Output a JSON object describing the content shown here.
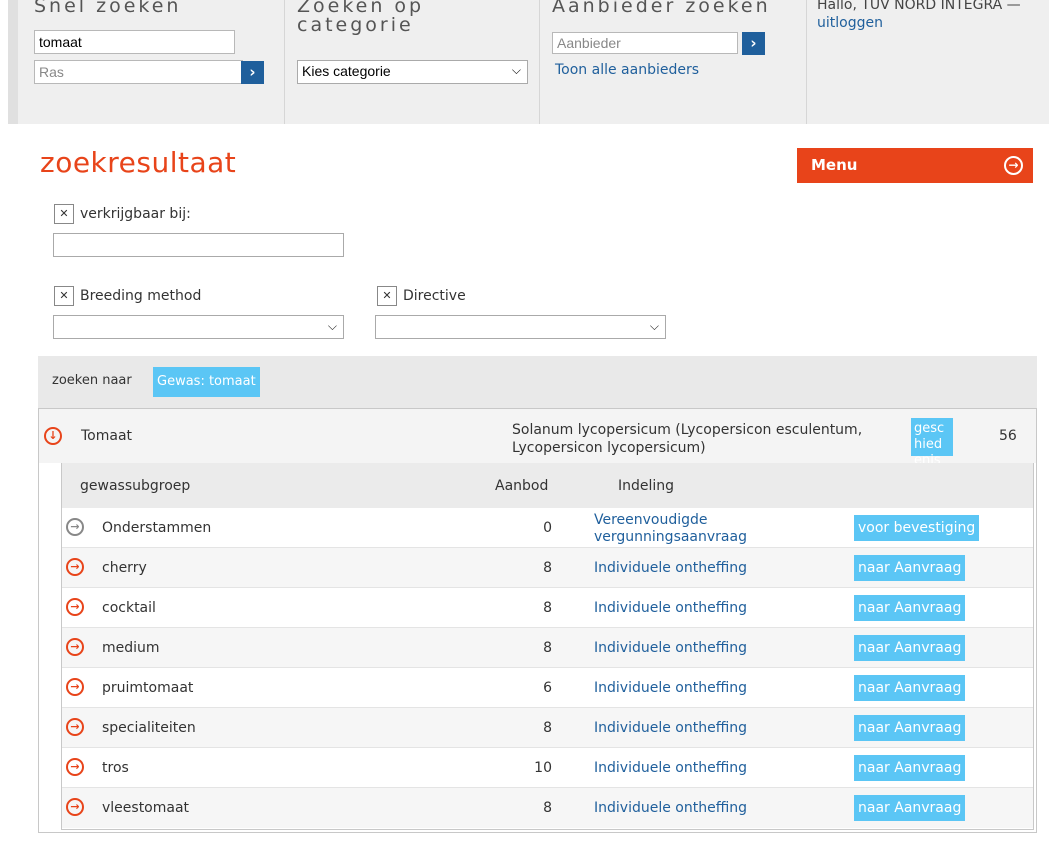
{
  "topbar": {
    "quick_search": {
      "title": "Snel zoeken",
      "crop_value": "tomaat",
      "variety_placeholder": "Ras"
    },
    "category_search": {
      "title_line1": "Zoeken op",
      "title_line2": "categorie",
      "selected": "Kies categorie"
    },
    "supplier_search": {
      "title": "Aanbieder zoeken",
      "placeholder": "Aanbieder",
      "show_all_link": "Toon alle aanbieders"
    },
    "user": {
      "greeting": "Hallo, TÜV NORD INTEGRA —",
      "logout_link": "uitloggen"
    }
  },
  "header": {
    "title": "zoekresultaat",
    "menu_label": "Menu"
  },
  "filters": {
    "available_at": {
      "label": "verkrijgbaar bij:",
      "value": ""
    },
    "breeding_method": {
      "label": "Breeding method",
      "selected": ""
    },
    "directive": {
      "label": "Directive",
      "selected": ""
    }
  },
  "search_for": {
    "label": "zoeken naar",
    "tag": "Gewas: tomaat"
  },
  "result": {
    "crop_name": "Tomaat",
    "latin_name": "Solanum lycopersicum (Lycopersicon esculentum, Lycopersicon lycopersicum)",
    "history_button": "geschiedenis",
    "count": "56",
    "columns": {
      "subgroup": "gewassubgroep",
      "offer": "Aanbod",
      "classification": "Indeling"
    },
    "rows": [
      {
        "name": "Onderstammen",
        "count": "0",
        "classification": "Vereenvoudigde vergunningsaanvraag",
        "action": "voor bevestiging",
        "icon": "grey"
      },
      {
        "name": "cherry",
        "count": "8",
        "classification": "Individuele ontheffing",
        "action": "naar Aanvraag",
        "icon": "orange"
      },
      {
        "name": "cocktail",
        "count": "8",
        "classification": "Individuele ontheffing",
        "action": "naar Aanvraag",
        "icon": "orange"
      },
      {
        "name": "medium",
        "count": "8",
        "classification": "Individuele ontheffing",
        "action": "naar Aanvraag",
        "icon": "orange"
      },
      {
        "name": "pruimtomaat",
        "count": "6",
        "classification": "Individuele ontheffing",
        "action": "naar Aanvraag",
        "icon": "orange"
      },
      {
        "name": "specialiteiten",
        "count": "8",
        "classification": "Individuele ontheffing",
        "action": "naar Aanvraag",
        "icon": "orange"
      },
      {
        "name": "tros",
        "count": "10",
        "classification": "Individuele ontheffing",
        "action": "naar Aanvraag",
        "icon": "orange"
      },
      {
        "name": "vleestomaat",
        "count": "8",
        "classification": "Individuele ontheffing",
        "action": "naar Aanvraag",
        "icon": "orange"
      }
    ]
  },
  "colors": {
    "accent_orange": "#e8441a",
    "tag_blue": "#5bc6f5",
    "link_blue": "#1f5f9c"
  }
}
